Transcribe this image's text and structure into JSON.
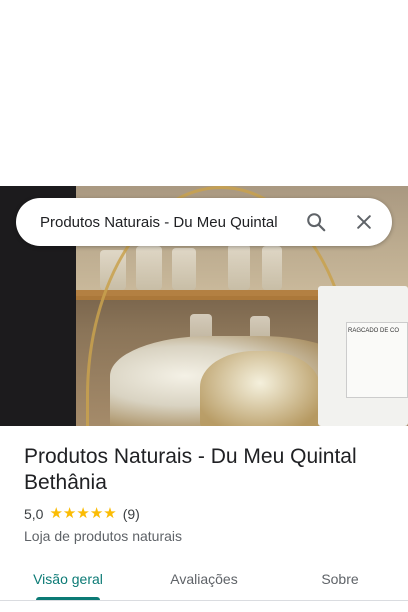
{
  "search": {
    "query": "Produtos Naturais - Du Meu Quintal",
    "search_icon": "search-icon",
    "close_icon": "close-icon"
  },
  "hero_photo": {
    "label_text": "RAGCADO DE CO"
  },
  "place": {
    "title": "Produtos Naturais - Du Meu Quintal Bethânia",
    "rating": "5,0",
    "stars": 5,
    "review_count": "(9)",
    "category": "Loja de produtos naturais"
  },
  "tabs": [
    {
      "label": "Visão geral",
      "active": true
    },
    {
      "label": "Avaliações",
      "active": false
    },
    {
      "label": "Sobre",
      "active": false
    }
  ],
  "colors": {
    "accent": "#0b7a75",
    "star": "#fbbc04"
  }
}
